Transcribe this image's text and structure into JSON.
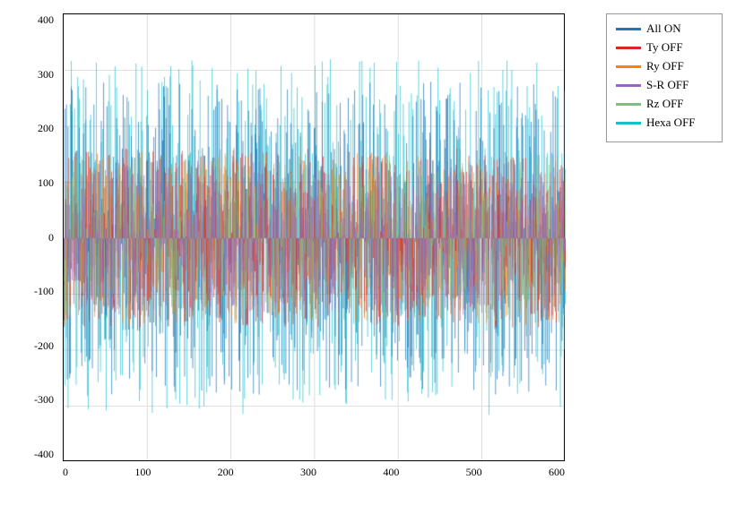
{
  "chart": {
    "title": "",
    "y_labels": [
      "400",
      "300",
      "200",
      "100",
      "0",
      "-100",
      "-200",
      "-300",
      "-400"
    ],
    "x_labels": [
      "0",
      "100",
      "200",
      "300",
      "400",
      "500",
      "600"
    ],
    "legend": [
      {
        "label": "All ON",
        "color": "#1f77b4"
      },
      {
        "label": "Ty OFF",
        "color": "#d62728"
      },
      {
        "label": "Ry OFF",
        "color": "#ff7f0e"
      },
      {
        "label": "S-R OFF",
        "color": "#9467bd"
      },
      {
        "label": "Rz OFF",
        "color": "#7fbf7f"
      },
      {
        "label": "Hexa OFF",
        "color": "#17becf"
      }
    ]
  }
}
